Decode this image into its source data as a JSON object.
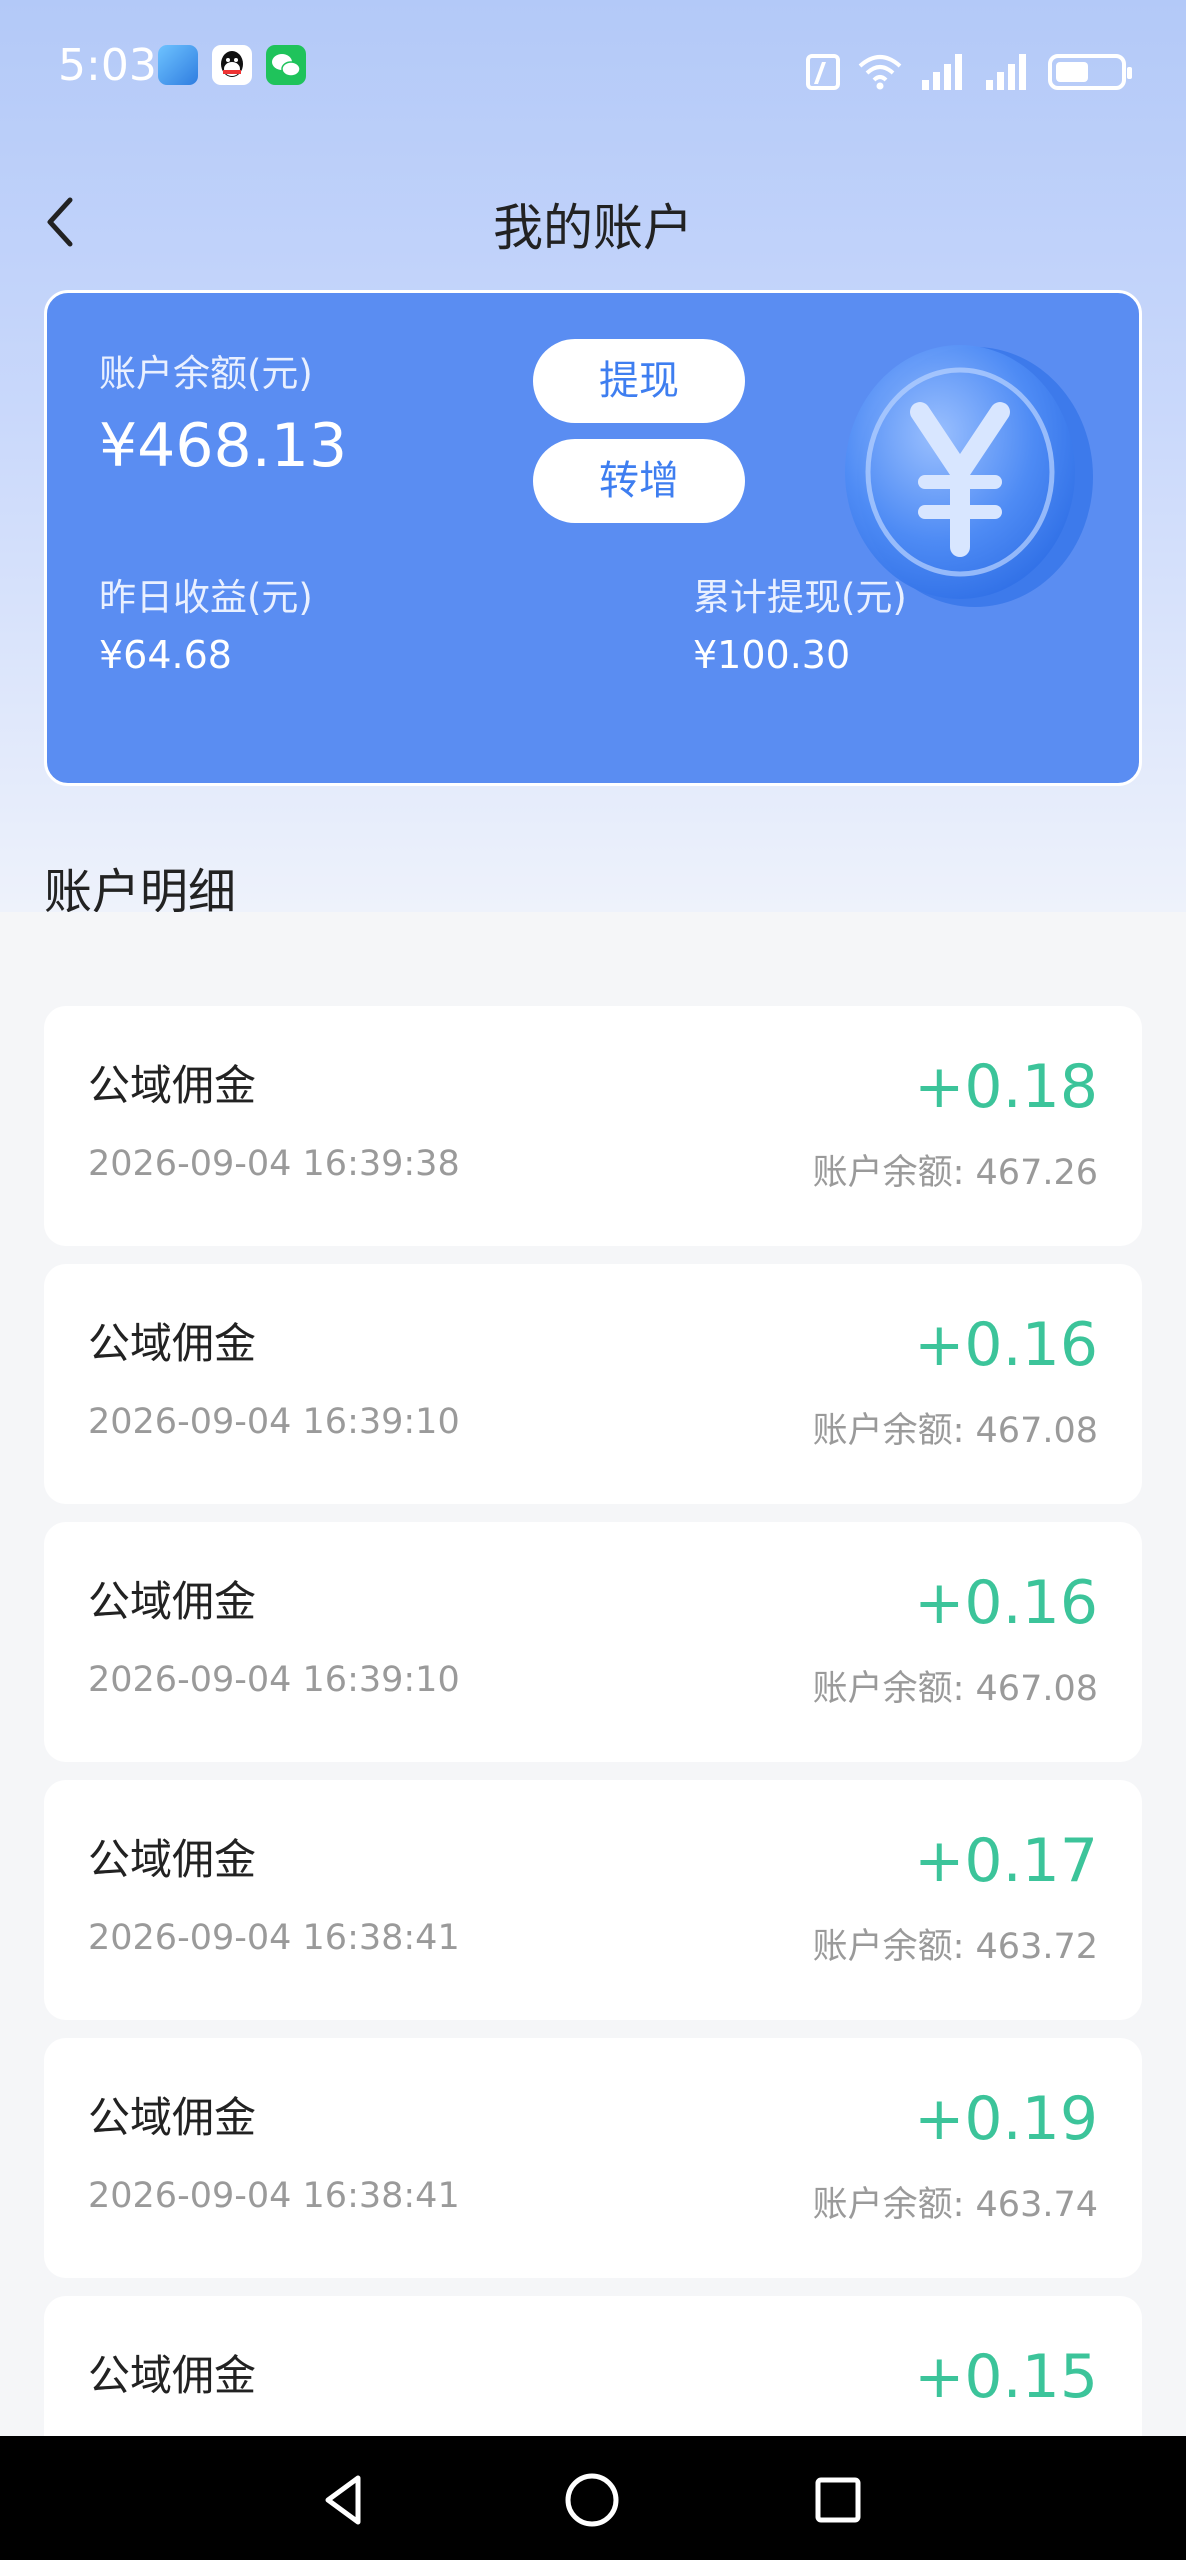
{
  "status_bar": {
    "time": "5:03",
    "icons": [
      "app-blue-icon",
      "qq-icon",
      "wechat-icon",
      "nfc-icon",
      "wifi-icon",
      "signal-icon",
      "signal-icon",
      "battery-icon"
    ],
    "battery_level": 0.46
  },
  "header": {
    "title": "我的账户",
    "back_icon": "chevron-left-icon"
  },
  "balance_card": {
    "balance_label": "账户余额(元)",
    "balance_value": "¥468.13",
    "withdraw_label": "提现",
    "transfer_label": "转增",
    "yesterday_label": "昨日收益(元)",
    "yesterday_value": "¥64.68",
    "total_withdraw_label": "累计提现(元)",
    "total_withdraw_value": "¥100.30",
    "coin_icon": "yuan-coin-icon"
  },
  "details": {
    "title": "账户明细",
    "items": [
      {
        "title": "公域佣金",
        "time": "2026-09-04 16:39:38",
        "amount": "+0.18",
        "balance": "账户余额: 467.26"
      },
      {
        "title": "公域佣金",
        "time": "2026-09-04 16:39:10",
        "amount": "+0.16",
        "balance": "账户余额: 467.08"
      },
      {
        "title": "公域佣金",
        "time": "2026-09-04 16:39:10",
        "amount": "+0.16",
        "balance": "账户余额: 467.08"
      },
      {
        "title": "公域佣金",
        "time": "2026-09-04 16:38:41",
        "amount": "+0.17",
        "balance": "账户余额: 463.72"
      },
      {
        "title": "公域佣金",
        "time": "2026-09-04 16:38:41",
        "amount": "+0.19",
        "balance": "账户余额: 463.74"
      },
      {
        "title": "公域佣金",
        "amount": "+0.15"
      }
    ]
  },
  "colors": {
    "card_bg": "#5a8df2",
    "amount_green": "#3cc49a",
    "button_text": "#3e7ef0"
  },
  "nav_bar": {
    "icons": [
      "back-triangle-icon",
      "home-circle-icon",
      "recents-square-icon"
    ]
  }
}
